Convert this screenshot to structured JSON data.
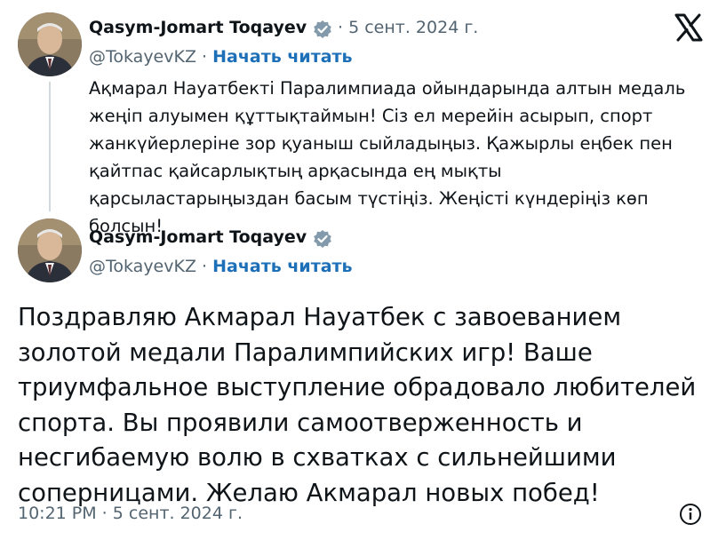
{
  "quoted_tweet": {
    "author_name": "Qasym-Jomart Toqayev",
    "date": "5 сент. 2024 г.",
    "handle": "@TokayevKZ",
    "follow_label": "Начать читать",
    "text": "Ақмарал Науатбекті Паралимпиада ойындарында алтын медаль жеңіп алуымен құттықтаймын! Сіз ел мерейін асырып, спорт жанкүйерлеріне зор қуаныш сыйладыңыз. Қажырлы еңбек пен қайтпас қайсарлықтың арқасында ең мықты қарсыластарыңыздан басым түстіңіз. Жеңісті күндеріңіз көп болсын!"
  },
  "main_tweet": {
    "author_name": "Qasym-Jomart Toqayev",
    "handle": "@TokayevKZ",
    "follow_label": "Начать читать",
    "text": "Поздравляю Акмарал Науатбек с завоеванием золотой медали Паралимпийских игр! Ваше триумфальное выступление обрадовало любителей спорта. Вы проявили самоотверженность и несгибаемую волю в схватках с сильнейшими соперницами. Желаю Акмарал новых побед!",
    "timestamp": "10:21 PM · 5 сент. 2024 г."
  },
  "separator": "·",
  "icons": {
    "verified": "verified-badge-icon",
    "x_logo": "x-logo-icon",
    "info": "info-icon"
  },
  "colors": {
    "link": "#1d6fb8",
    "verified": "#829aab",
    "secondary_text": "#536471",
    "thread_line": "#cfd9de"
  }
}
